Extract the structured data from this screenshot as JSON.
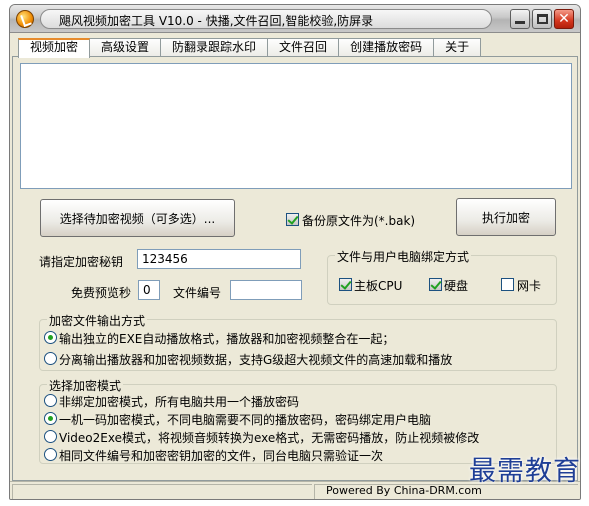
{
  "window": {
    "title": "飓风视频加密工具 V10.0 - 快播,文件召回,智能校验,防屏录"
  },
  "tabs": [
    {
      "label": "视频加密",
      "active": true
    },
    {
      "label": "高级设置",
      "active": false
    },
    {
      "label": "防翻录跟踪水印",
      "active": false
    },
    {
      "label": "文件召回",
      "active": false
    },
    {
      "label": "创建播放密码",
      "active": false
    },
    {
      "label": "关于",
      "active": false
    }
  ],
  "main": {
    "log_text": "",
    "select_button": "选择待加密视频（可多选）...",
    "backup_label": "备份原文件为(*.bak)",
    "backup_checked": true,
    "encrypt_button": "执行加密",
    "key_label": "请指定加密秘钥",
    "key_value": "123456",
    "preview_label": "免费预览秒",
    "preview_value": "0",
    "file_no_label": "文件编号",
    "file_no_value": ""
  },
  "binding_group": {
    "title": "文件与用户电脑绑定方式",
    "options": [
      {
        "label": "主板CPU",
        "checked": true
      },
      {
        "label": "硬盘",
        "checked": true
      },
      {
        "label": "网卡",
        "checked": false
      }
    ]
  },
  "output_group": {
    "title": "加密文件输出方式",
    "options": [
      {
        "label": "输出独立的EXE自动播放格式，播放器和加密视频整合在一起；",
        "checked": true
      },
      {
        "label": "分离输出播放器和加密视频数据，支持G级超大视频文件的高速加载和播放",
        "checked": false
      }
    ]
  },
  "mode_group": {
    "title": "选择加密模式",
    "options": [
      {
        "label": "非绑定加密模式，所有电脑共用一个播放密码",
        "checked": false
      },
      {
        "label": "一机一码加密模式，不同电脑需要不同的播放密码，密码绑定用户电脑",
        "checked": true
      },
      {
        "label": "Video2Exe模式，将视频音频转换为exe格式，无需密码播放，防止视频被修改",
        "checked": false
      },
      {
        "label": "相同文件编号和加密密钥加密的文件，同台电脑只需验证一次",
        "checked": false
      }
    ]
  },
  "status_bar": {
    "text": "Powered By China-DRM.com"
  },
  "watermark": {
    "text": "最需教育"
  },
  "colors": {
    "checkmark": "#21a121",
    "active_tab_accent": "#e68b2c",
    "close_button": "#d4361e",
    "watermark": "#1f3f96"
  }
}
